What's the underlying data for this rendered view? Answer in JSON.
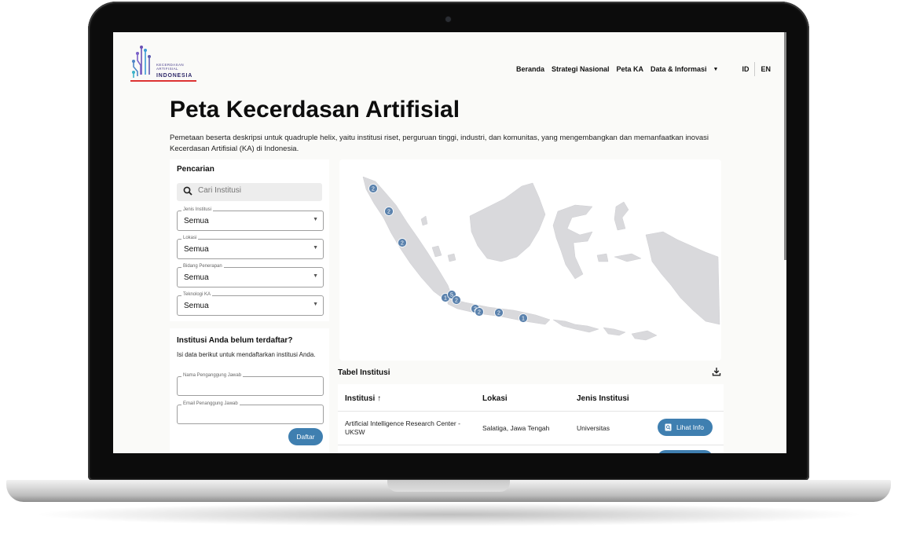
{
  "logo": {
    "line1": "KECERDASAN",
    "line2": "ARTIFISIAL",
    "line3": "INDONESIA"
  },
  "nav": {
    "items": [
      "Beranda",
      "Strategi Nasional",
      "Peta KA",
      "Data & Informasi"
    ],
    "lang_id": "ID",
    "lang_en": "EN"
  },
  "page": {
    "title": "Peta Kecerdasan Artifisial",
    "description": "Pemetaan beserta deskripsi untuk quadruple helix, yaitu institusi riset, perguruan tinggi, industri, dan komunitas, yang mengembangkan dan memanfaatkan inovasi Kecerdasan Artifisial (KA) di Indonesia."
  },
  "search": {
    "heading": "Pencarian",
    "placeholder": "Cari Institusi",
    "filters": [
      {
        "label": "Jenis Institusi",
        "value": "Semua"
      },
      {
        "label": "Lokasi",
        "value": "Semua"
      },
      {
        "label": "Bidang Penerapan",
        "value": "Semua"
      },
      {
        "label": "Teknologi KA",
        "value": "Semua"
      }
    ]
  },
  "register": {
    "heading": "Institusi Anda belum terdaftar?",
    "description": "Isi data berikut untuk mendaftarkan institusi Anda.",
    "name_label": "Nama Penganggung Jawab",
    "email_label": "Email Penanggung Jawab",
    "submit": "Daftar"
  },
  "map": {
    "markers": [
      "2",
      "2",
      "2",
      "1",
      "5",
      "2",
      "2",
      "2",
      "2",
      "1"
    ],
    "marker_color": "#5b82ad"
  },
  "table": {
    "title": "Tabel Institusi",
    "columns": [
      "Institusi ↑",
      "Lokasi",
      "Jenis Institusi"
    ],
    "rows": [
      {
        "institusi": "Artificial Intelligence Research Center - UKSW",
        "lokasi": "Salatiga, Jawa Tengah",
        "jenis": "Universitas",
        "action": "Lihat Info"
      }
    ]
  },
  "colors": {
    "accent": "#3f7fb0",
    "page_bg": "#fafaf8",
    "map_land": "#d9d9dc"
  }
}
